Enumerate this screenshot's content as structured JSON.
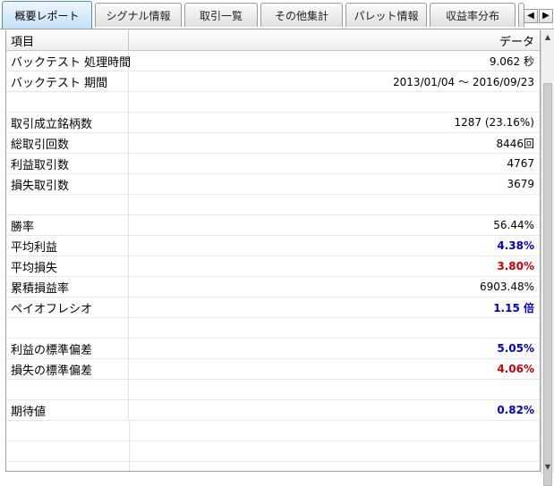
{
  "tabs": [
    {
      "label": "概要レポート",
      "active": true
    },
    {
      "label": "シグナル情報",
      "active": false
    },
    {
      "label": "取引一覧",
      "active": false
    },
    {
      "label": "その他集計",
      "active": false
    },
    {
      "label": "パレット情報",
      "active": false
    },
    {
      "label": "収益率分布",
      "active": false
    },
    {
      "label": "",
      "active": false
    }
  ],
  "tab_nav": {
    "prev": "◀",
    "next": "▶"
  },
  "table": {
    "headers": {
      "item": "項目",
      "data": "データ"
    },
    "rows": [
      {
        "label": "バックテスト 処理時間",
        "value": "9.062 秒",
        "style": "normal"
      },
      {
        "label": "バックテスト 期間",
        "value": "2013/01/04 ～ 2016/09/23",
        "style": "normal"
      },
      {
        "label": "",
        "value": "",
        "style": "normal"
      },
      {
        "label": "取引成立銘柄数",
        "value": "1287 (23.16%)",
        "style": "normal"
      },
      {
        "label": "総取引回数",
        "value": "8446回",
        "style": "normal"
      },
      {
        "label": "利益取引数",
        "value": "4767",
        "style": "normal"
      },
      {
        "label": "損失取引数",
        "value": "3679",
        "style": "normal"
      },
      {
        "label": "",
        "value": "",
        "style": "normal"
      },
      {
        "label": "勝率",
        "value": "56.44%",
        "style": "normal"
      },
      {
        "label": "平均利益",
        "value": "4.38%",
        "style": "blue"
      },
      {
        "label": "平均損失",
        "value": "3.80%",
        "style": "red"
      },
      {
        "label": "累積損益率",
        "value": "6903.48%",
        "style": "normal"
      },
      {
        "label": "ペイオフレシオ",
        "value": "1.15 倍",
        "style": "blue"
      },
      {
        "label": "",
        "value": "",
        "style": "normal"
      },
      {
        "label": "利益の標準偏差",
        "value": "5.05%",
        "style": "blue"
      },
      {
        "label": "損失の標準偏差",
        "value": "4.06%",
        "style": "red"
      },
      {
        "label": "",
        "value": "",
        "style": "normal"
      },
      {
        "label": "期待値",
        "value": "0.82%",
        "style": "blue"
      }
    ]
  },
  "scrollbar": {
    "up": "▲",
    "down": "▼"
  }
}
